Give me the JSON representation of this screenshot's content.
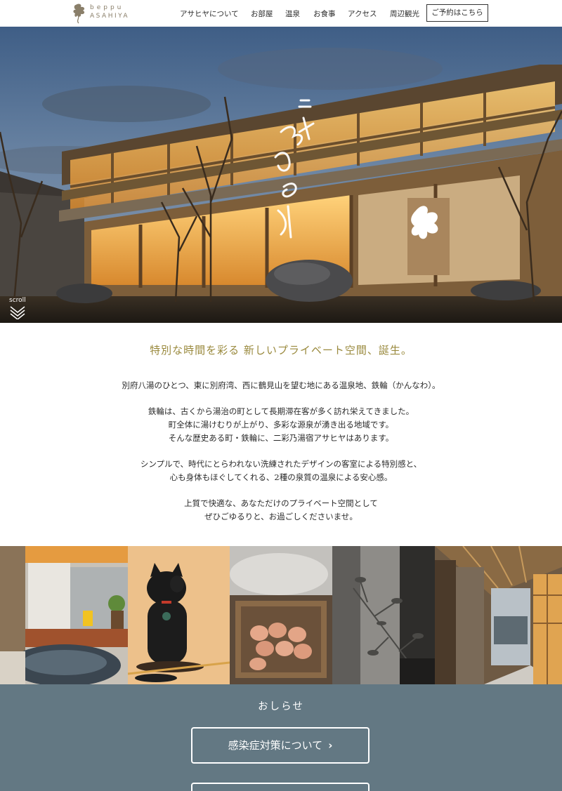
{
  "header": {
    "logo_top": "beppu",
    "logo_bottom": "ASAHIYA",
    "nav": [
      "アサヒヤについて",
      "お部屋",
      "温泉",
      "お食事",
      "アクセス",
      "周辺観光"
    ],
    "reserve_label": "ご予約はこちら"
  },
  "hero": {
    "scroll_label": "scroll"
  },
  "intro": {
    "heading": "特別な時間を彩る 新しいプライベート空間、誕生。",
    "paragraphs": [
      [
        "別府八湯のひとつ、東に別府湾、西に鶴見山を望む地にある温泉地、鉄輪（かんなわ）。"
      ],
      [
        "鉄輪は、古くから湯治の町として長期滞在客が多く訪れ栄えてきました。",
        "町全体に湯けむりが上がり、多彩な源泉が湧き出る地域です。",
        "そんな歴史ある町・鉄輪に、二彩乃湯宿アサヒヤはあります。"
      ],
      [
        "シンプルで、時代にとらわれない洗練されたデザインの客室による特別感と、",
        "心も身体もほぐしてくれる、2種の泉質の温泉による安心感。"
      ],
      [
        "上質で快適な、あなただけのプライベート空間として",
        "ぜひごゆるりと、お過ごしくださいませ。"
      ]
    ]
  },
  "news": {
    "title": "おしらせ",
    "buttons": [
      "感染症対策について",
      ""
    ]
  },
  "colors": {
    "accent_gold": "#9a8a3e",
    "news_bg": "#637883",
    "logo": "#8a7f6a"
  }
}
